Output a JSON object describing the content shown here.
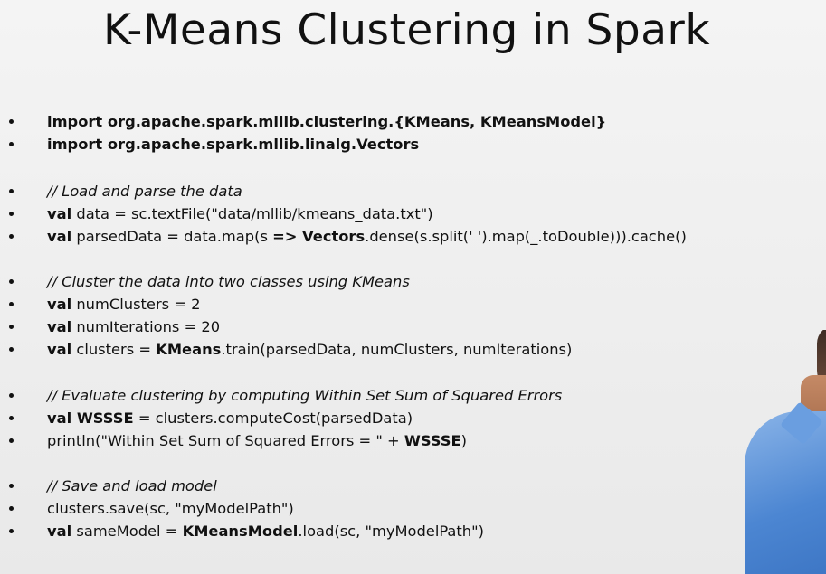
{
  "title": "K-Means Clustering in Spark",
  "lines": [
    {
      "t": "import org.apache.spark.mllib.clustering.{KMeans, KMeansModel}"
    },
    {
      "t": "import org.apache.spark.mllib.linalg.Vectors"
    },
    {
      "t": "// Load and parse the data"
    },
    {
      "kw": "val",
      "t": " data = sc.textFile(\"data/mllib/kmeans_data.txt\")"
    },
    {
      "kw": "val",
      "t1": " parsedData = data.map(s ",
      "b1": "=> Vectors",
      "t2": ".dense(s.split(' ').map(_.toDouble))).cache()"
    },
    {
      "t": "// Cluster the data into two classes using KMeans"
    },
    {
      "kw": "val",
      "t": " numClusters = 2"
    },
    {
      "kw": "val",
      "t": " numIterations = 20"
    },
    {
      "kw": "val",
      "t1": " clusters = ",
      "b1": "KMeans",
      "t2": ".train(parsedData, numClusters, numIterations)"
    },
    {
      "t": "// Evaluate clustering by computing Within Set Sum of Squared Errors"
    },
    {
      "kw": "val WSSSE",
      "t": " = clusters.computeCost(parsedData)"
    },
    {
      "t1": "println(\"Within Set Sum of Squared Errors = \" + ",
      "b1": "WSSSE",
      "t2": ")"
    },
    {
      "t": "// Save and load model"
    },
    {
      "t": "clusters.save(sc, \"myModelPath\")"
    },
    {
      "kw": "val",
      "t1": " sameModel = ",
      "b1": "KMeansModel",
      "t2": ".load(sc, \"myModelPath\")"
    }
  ]
}
